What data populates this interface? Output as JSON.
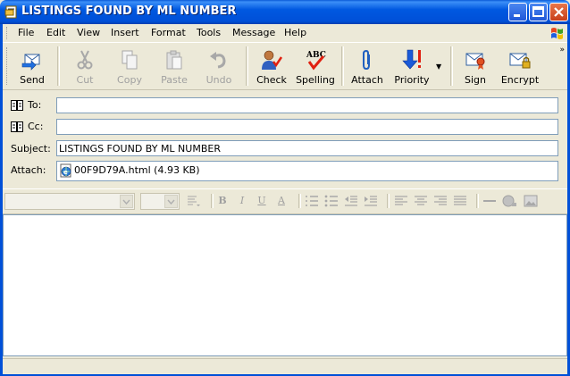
{
  "window": {
    "title": "LISTINGS FOUND BY ML NUMBER"
  },
  "menu": [
    "File",
    "Edit",
    "View",
    "Insert",
    "Format",
    "Tools",
    "Message",
    "Help"
  ],
  "toolbar": {
    "send": "Send",
    "cut": "Cut",
    "copy": "Copy",
    "paste": "Paste",
    "undo": "Undo",
    "check": "Check",
    "spelling": "Spelling",
    "attach": "Attach",
    "priority": "Priority",
    "sign": "Sign",
    "encrypt": "Encrypt"
  },
  "fields": {
    "to_label": "To:",
    "to_value": "",
    "cc_label": "Cc:",
    "cc_value": "",
    "subject_label": "Subject:",
    "subject_value": "LISTINGS FOUND BY ML NUMBER",
    "attach_label": "Attach:",
    "attachment": "00F9D79A.html (4.93 KB)"
  },
  "format": {
    "bold": "B",
    "italic": "I",
    "underline": "U",
    "font_color": "A"
  },
  "icons": {
    "send": "send-icon",
    "cut": "cut-icon",
    "copy": "copy-icon",
    "paste": "paste-icon",
    "undo": "undo-icon",
    "check": "check-names-icon",
    "spelling": "spelling-icon",
    "attach": "paperclip-icon",
    "priority": "priority-icon",
    "sign": "sign-icon",
    "encrypt": "encrypt-icon"
  }
}
